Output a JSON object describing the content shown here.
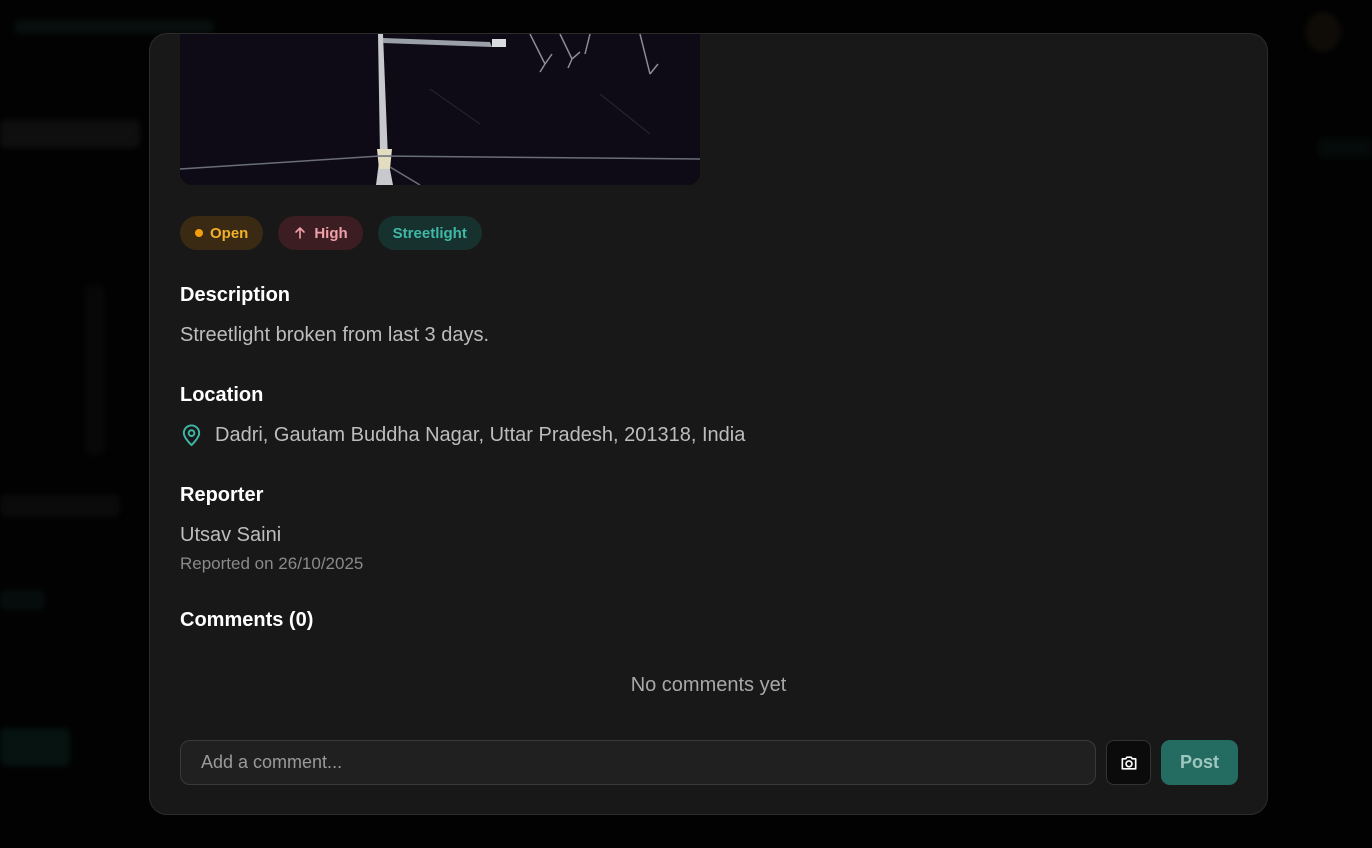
{
  "colors": {
    "modal_background": "#181818",
    "status_open": "#f0b02a",
    "priority_high": "#f0a0aa",
    "category_accent": "#3fb8a6",
    "post_button": "#246b61"
  },
  "issue": {
    "status_label": "Open",
    "priority_icon": "arrow-up-icon",
    "priority_label": "High",
    "category_label": "Streetlight",
    "description_heading": "Description",
    "description_text": "Streetlight broken from last 3 days.",
    "location_heading": "Location",
    "location_icon": "map-pin-icon",
    "location_text": "Dadri, Gautam Buddha Nagar, Uttar Pradesh, 201318, India",
    "reporter_heading": "Reporter",
    "reporter_name": "Utsav Saini",
    "reported_on": "Reported on 26/10/2025"
  },
  "comments": {
    "heading": "Comments (0)",
    "empty_text": "No comments yet",
    "input_placeholder": "Add a comment...",
    "input_value": "",
    "attach_icon": "camera-icon",
    "post_label": "Post"
  }
}
